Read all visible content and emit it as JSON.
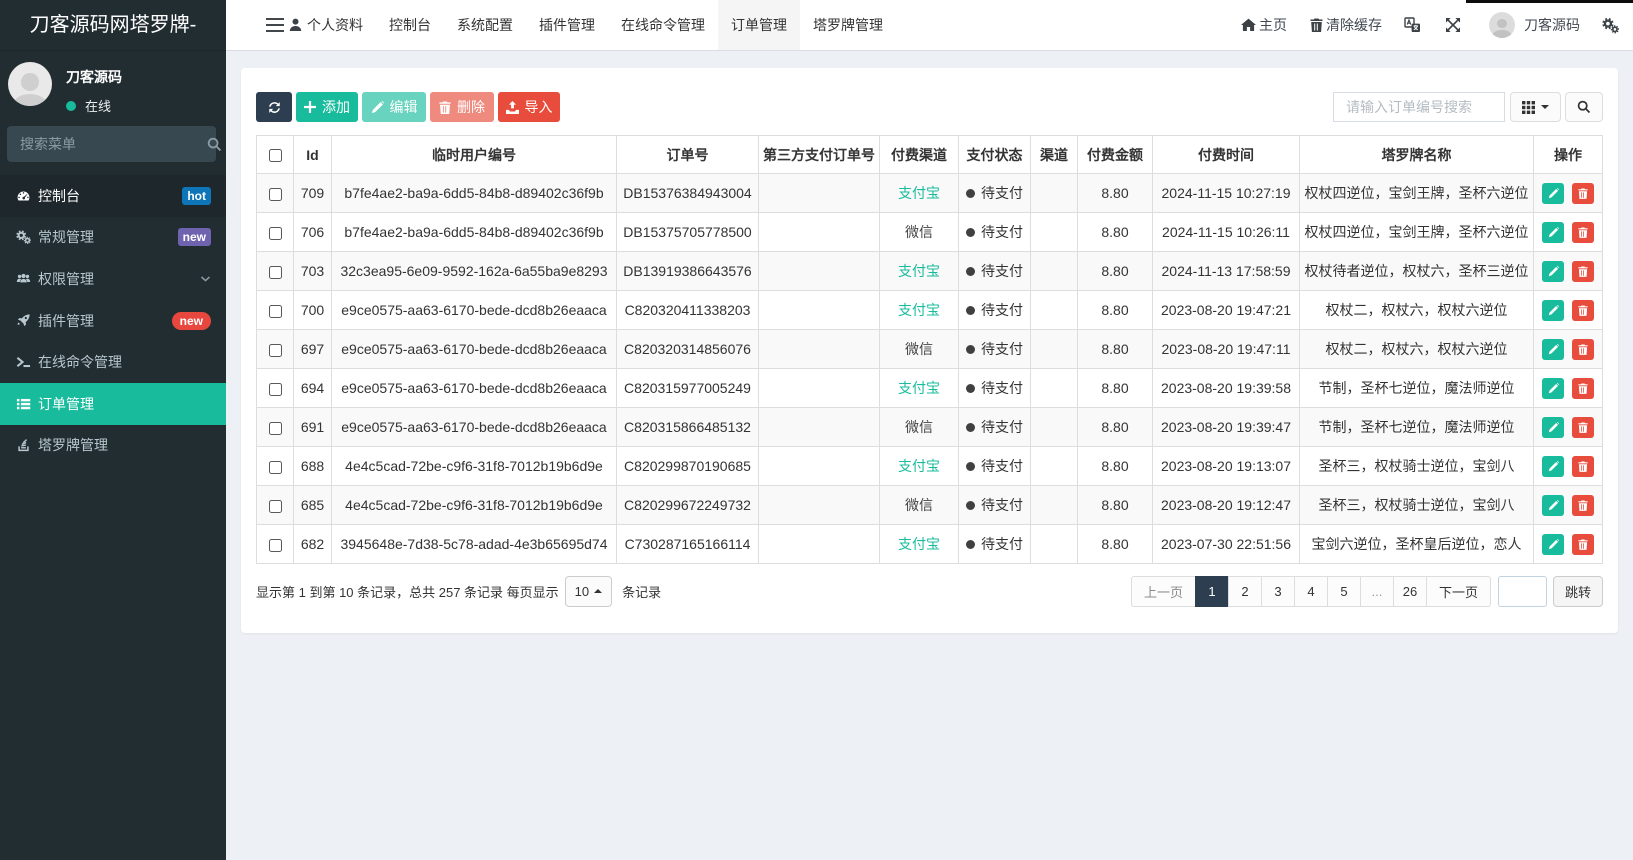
{
  "colors": {
    "accent": "#18bc9c",
    "primary_dark": "#2c3e50",
    "danger": "#e74c3c",
    "sidebar_bg": "#222d32",
    "badge_blue": "#0e76b8",
    "badge_purple": "#6f63b0",
    "badge_red": "#e7473c",
    "channel_map": {
      "支付宝": "#18bc9c",
      "微信": "#444444"
    }
  },
  "sidebar": {
    "logo": "刀客源码网塔罗牌-",
    "user": {
      "name": "刀客源码",
      "status": "在线"
    },
    "search_placeholder": "搜索菜单",
    "menu": [
      {
        "label": "控制台",
        "icon": "dashboard-icon",
        "badge": "hot",
        "badge_type": "blue"
      },
      {
        "label": "常规管理",
        "icon": "gears-icon",
        "badge": "new",
        "badge_type": "purple"
      },
      {
        "label": "权限管理",
        "icon": "users-icon"
      },
      {
        "label": "插件管理",
        "icon": "rocket-icon",
        "badge": "new",
        "badge_type": "redpill"
      },
      {
        "label": "在线命令管理",
        "icon": "terminal-icon"
      },
      {
        "label": "订单管理",
        "icon": "list-icon",
        "active": true
      },
      {
        "label": "塔罗牌管理",
        "icon": "stack-icon"
      }
    ]
  },
  "topnav": {
    "tabs": [
      {
        "label": "个人资料",
        "icon": "user-icon"
      },
      {
        "label": "控制台"
      },
      {
        "label": "系统配置"
      },
      {
        "label": "插件管理"
      },
      {
        "label": "在线命令管理"
      },
      {
        "label": "订单管理",
        "active": true
      },
      {
        "label": "塔罗牌管理"
      }
    ],
    "home_label": "主页",
    "clear_cache_label": "清除缓存",
    "username": "刀客源码"
  },
  "toolbar": {
    "add_label": "添加",
    "edit_label": "编辑",
    "delete_label": "删除",
    "import_label": "导入",
    "search_placeholder": "请输入订单编号搜索"
  },
  "table": {
    "columns": [
      "Id",
      "临时用户编号",
      "订单号",
      "第三方支付订单号",
      "付费渠道",
      "支付状态",
      "渠道",
      "付费金额",
      "付费时间",
      "塔罗牌名称",
      "操作"
    ],
    "rows": [
      {
        "id": "709",
        "uuid": "b7fe4ae2-ba9a-6dd5-84b8-d89402c36f9b",
        "order_no": "DB15376384943004",
        "third_party": "",
        "channel": "支付宝",
        "status": "待支付",
        "qudao": "",
        "amount": "8.80",
        "time": "2024-11-15 10:27:19",
        "tarot": "权杖四逆位，宝剑王牌，圣杯六逆位"
      },
      {
        "id": "706",
        "uuid": "b7fe4ae2-ba9a-6dd5-84b8-d89402c36f9b",
        "order_no": "DB15375705778500",
        "third_party": "",
        "channel": "微信",
        "status": "待支付",
        "qudao": "",
        "amount": "8.80",
        "time": "2024-11-15 10:26:11",
        "tarot": "权杖四逆位，宝剑王牌，圣杯六逆位"
      },
      {
        "id": "703",
        "uuid": "32c3ea95-6e09-9592-162a-6a55ba9e8293",
        "order_no": "DB13919386643576",
        "third_party": "",
        "channel": "支付宝",
        "status": "待支付",
        "qudao": "",
        "amount": "8.80",
        "time": "2024-11-13 17:58:59",
        "tarot": "权杖待者逆位，权杖六，圣杯三逆位"
      },
      {
        "id": "700",
        "uuid": "e9ce0575-aa63-6170-bede-dcd8b26eaaca",
        "order_no": "C820320411338203",
        "third_party": "",
        "channel": "支付宝",
        "status": "待支付",
        "qudao": "",
        "amount": "8.80",
        "time": "2023-08-20 19:47:21",
        "tarot": "权杖二，权杖六，权杖六逆位"
      },
      {
        "id": "697",
        "uuid": "e9ce0575-aa63-6170-bede-dcd8b26eaaca",
        "order_no": "C820320314856076",
        "third_party": "",
        "channel": "微信",
        "status": "待支付",
        "qudao": "",
        "amount": "8.80",
        "time": "2023-08-20 19:47:11",
        "tarot": "权杖二，权杖六，权杖六逆位"
      },
      {
        "id": "694",
        "uuid": "e9ce0575-aa63-6170-bede-dcd8b26eaaca",
        "order_no": "C820315977005249",
        "third_party": "",
        "channel": "支付宝",
        "status": "待支付",
        "qudao": "",
        "amount": "8.80",
        "time": "2023-08-20 19:39:58",
        "tarot": "节制，圣杯七逆位，魔法师逆位"
      },
      {
        "id": "691",
        "uuid": "e9ce0575-aa63-6170-bede-dcd8b26eaaca",
        "order_no": "C820315866485132",
        "third_party": "",
        "channel": "微信",
        "status": "待支付",
        "qudao": "",
        "amount": "8.80",
        "time": "2023-08-20 19:39:47",
        "tarot": "节制，圣杯七逆位，魔法师逆位"
      },
      {
        "id": "688",
        "uuid": "4e4c5cad-72be-c9f6-31f8-7012b19b6d9e",
        "order_no": "C820299870190685",
        "third_party": "",
        "channel": "支付宝",
        "status": "待支付",
        "qudao": "",
        "amount": "8.80",
        "time": "2023-08-20 19:13:07",
        "tarot": "圣杯三，权杖骑士逆位，宝剑八"
      },
      {
        "id": "685",
        "uuid": "4e4c5cad-72be-c9f6-31f8-7012b19b6d9e",
        "order_no": "C820299672249732",
        "third_party": "",
        "channel": "微信",
        "status": "待支付",
        "qudao": "",
        "amount": "8.80",
        "time": "2023-08-20 19:12:47",
        "tarot": "圣杯三，权杖骑士逆位，宝剑八"
      },
      {
        "id": "682",
        "uuid": "3945648e-7d38-5c78-adad-4e3b65695d74",
        "order_no": "C730287165166114",
        "third_party": "",
        "channel": "支付宝",
        "status": "待支付",
        "qudao": "",
        "amount": "8.80",
        "time": "2023-07-30 22:51:56",
        "tarot": "宝剑六逆位，圣杯皇后逆位，恋人"
      }
    ]
  },
  "pagination": {
    "summary_prefix": "显示第 1 到第 10 条记录，总共 257 条记录 每页显示",
    "page_size": "10",
    "summary_suffix": "条记录",
    "prev_label": "上一页",
    "next_label": "下一页",
    "pages": [
      "1",
      "2",
      "3",
      "4",
      "5",
      "...",
      "26"
    ],
    "active_page": "1",
    "jump_value": "",
    "jump_label": "跳转"
  }
}
